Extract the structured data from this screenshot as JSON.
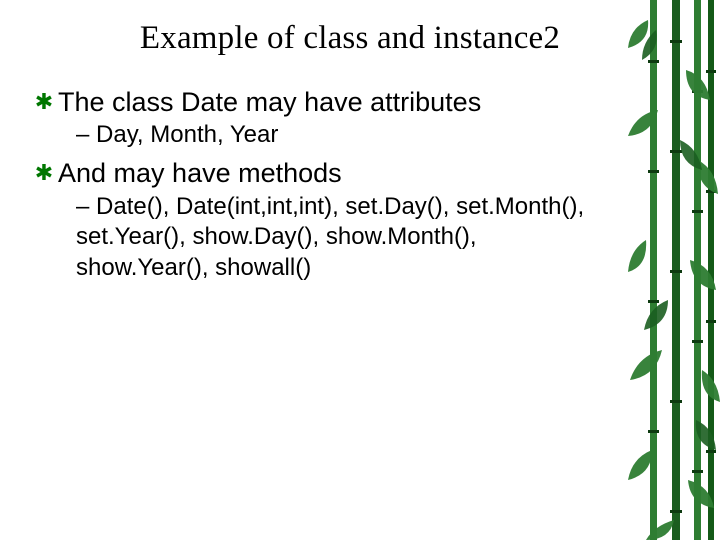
{
  "title": "Example of class and instance2",
  "points": [
    {
      "text": "The class Date may have attributes",
      "sub": "– Day, Month, Year"
    },
    {
      "text": "And may have methods",
      "sub": "– Date(), Date(int,int,int), set.Day(), set.Month(), set.Year(), show.Day(), show.Month(), show.Year(), showall()"
    }
  ]
}
